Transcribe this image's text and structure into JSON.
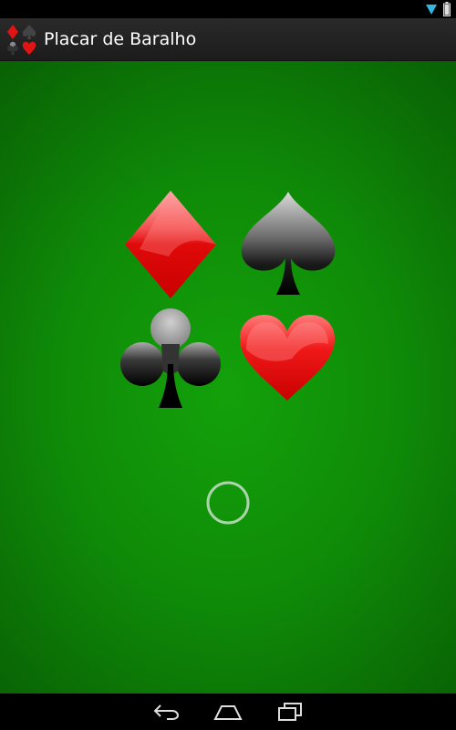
{
  "app": {
    "title": "Placar de Baralho"
  },
  "icons": {
    "app_icon": "card-suits-icon",
    "wifi": "wifi-icon",
    "battery": "battery-icon",
    "spinner": "loading-spinner-icon",
    "back": "back-icon",
    "home": "home-icon",
    "recents": "recent-apps-icon"
  },
  "suits": [
    "diamond",
    "spade",
    "club",
    "heart"
  ],
  "colors": {
    "background": "#13a10a",
    "red_suit": "#e01010",
    "black_suit": "#1a1a1a"
  }
}
